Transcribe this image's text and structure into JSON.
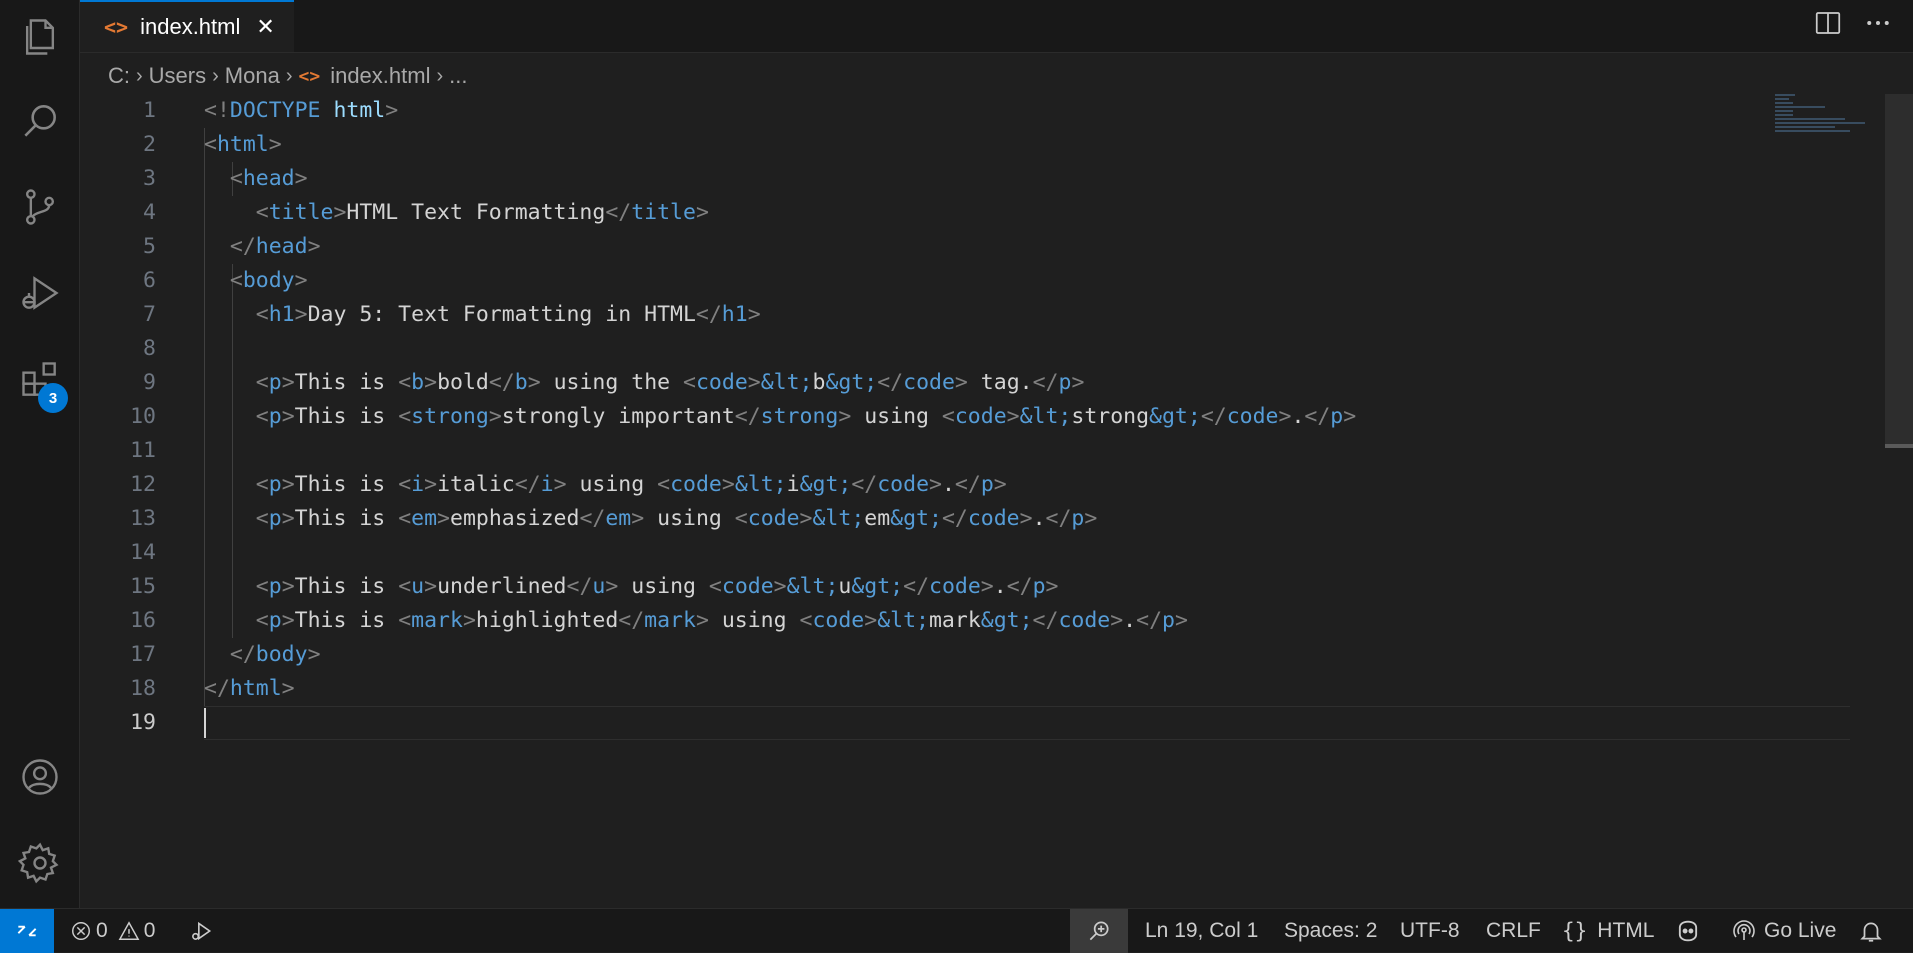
{
  "tab": {
    "icon": "<>",
    "filename": "index.html",
    "close": "✕"
  },
  "breadcrumb": {
    "drive": "C:",
    "folder1": "Users",
    "folder2": "Mona",
    "file": "index.html",
    "more": "..."
  },
  "activity_bar": {
    "extensions_badge": "3"
  },
  "editor": {
    "active_line": 19,
    "line_numbers": [
      "1",
      "2",
      "3",
      "4",
      "5",
      "6",
      "7",
      "8",
      "9",
      "10",
      "11",
      "12",
      "13",
      "14",
      "15",
      "16",
      "17",
      "18",
      "19"
    ]
  },
  "status": {
    "errors": "0",
    "warnings": "0",
    "position": "Ln 19, Col 1",
    "spaces": "Spaces: 2",
    "encoding": "UTF-8",
    "eol": "CRLF",
    "language_icon": "{}",
    "language": "HTML",
    "go_live": "Go Live"
  },
  "colors": {
    "accent": "#0078d4",
    "tag": "#569cd6",
    "text": "#d4d4d4",
    "bracket": "#808080",
    "html_icon": "#e37933"
  }
}
